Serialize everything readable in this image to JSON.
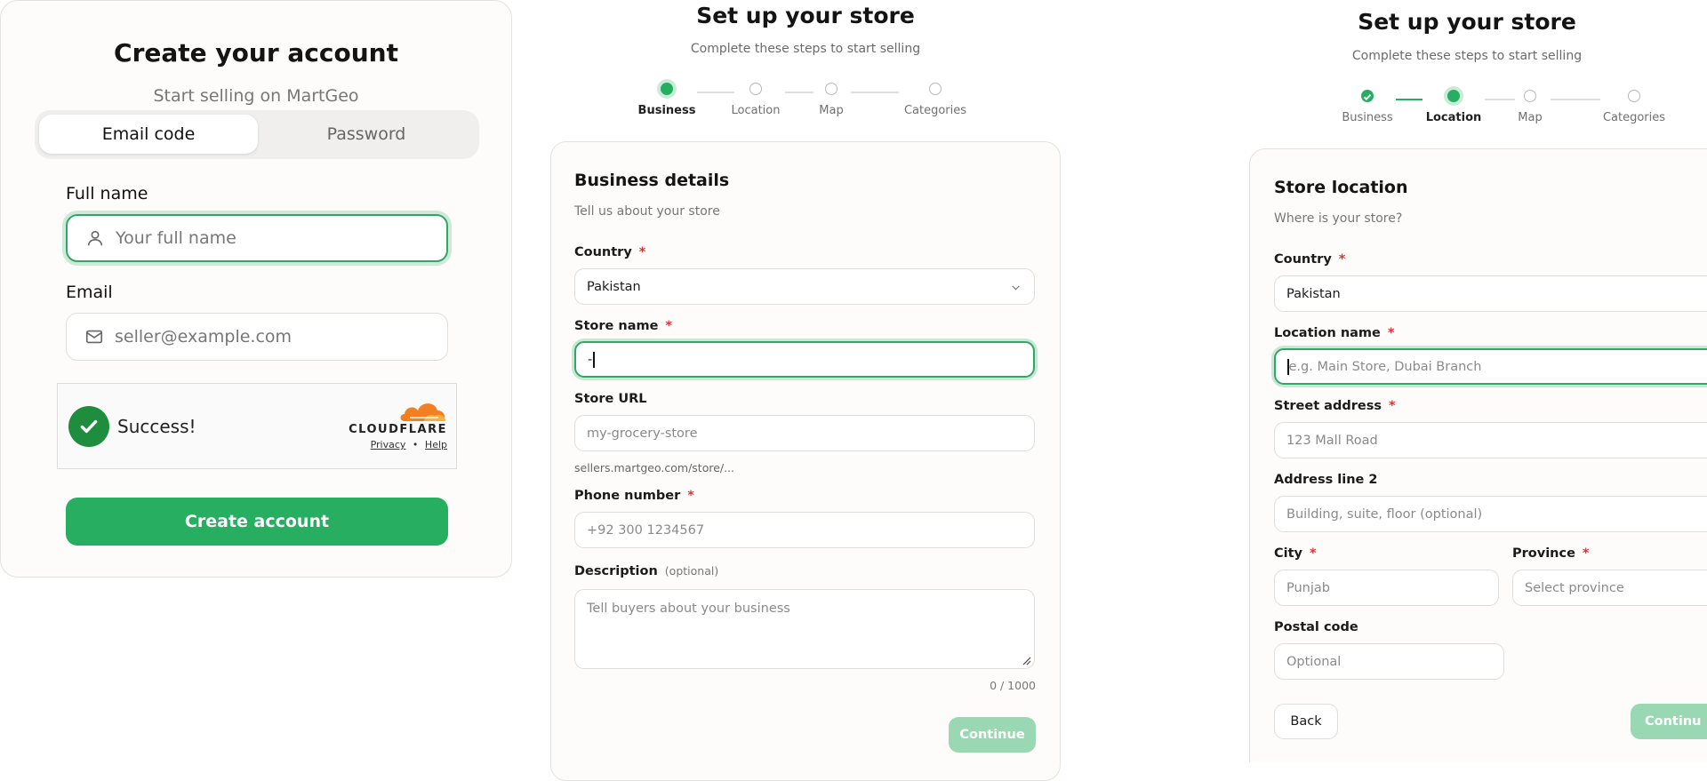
{
  "signup": {
    "title": "Create your account",
    "subtitle": "Start selling on MartGeo",
    "tabs": [
      {
        "label": "Email code",
        "active": true
      },
      {
        "label": "Password",
        "active": false
      }
    ],
    "full_name": {
      "label": "Full name",
      "placeholder": "Your full name",
      "icon": "user-icon"
    },
    "email": {
      "label": "Email",
      "placeholder": "seller@example.com",
      "icon": "mail-icon"
    },
    "captcha": {
      "status": "Success!",
      "brand": "CLOUDFLARE",
      "privacy": "Privacy",
      "separator": "•",
      "help": "Help"
    },
    "submit_label": "Create account",
    "accent": "#27ae60"
  },
  "setup_business": {
    "title": "Set up your store",
    "subtitle": "Complete these steps to start selling",
    "steps": [
      "Business",
      "Location",
      "Map",
      "Categories"
    ],
    "current_step": 0,
    "card": {
      "title": "Business details",
      "subtitle": "Tell us about your store",
      "country": {
        "label": "Country",
        "value": "Pakistan"
      },
      "store_name": {
        "label": "Store name",
        "value": "-"
      },
      "store_url": {
        "label": "Store URL",
        "placeholder": "my-grocery-store",
        "hint": "sellers.martgeo.com/store/..."
      },
      "phone": {
        "label": "Phone number",
        "placeholder": "+92 300 1234567"
      },
      "description": {
        "label": "Description",
        "optional_tag": "(optional)",
        "placeholder": "Tell buyers about your business",
        "counter": "0 / 1000"
      },
      "continue_label": "Continue"
    },
    "required_mark": "*"
  },
  "setup_location": {
    "title": "Set up your store",
    "subtitle": "Complete these steps to start selling",
    "steps": [
      "Business",
      "Location",
      "Map",
      "Categories"
    ],
    "current_step": 1,
    "card": {
      "title": "Store location",
      "subtitle": "Where is your store?",
      "country": {
        "label": "Country",
        "value": "Pakistan"
      },
      "location_name": {
        "label": "Location name",
        "placeholder": "e.g. Main Store, Dubai Branch"
      },
      "street": {
        "label": "Street address",
        "placeholder": "123 Mall Road"
      },
      "address2": {
        "label": "Address line 2",
        "placeholder": "Building, suite, floor (optional)"
      },
      "city": {
        "label": "City",
        "placeholder": "Punjab"
      },
      "province": {
        "label": "Province",
        "placeholder": "Select province"
      },
      "postal": {
        "label": "Postal code",
        "placeholder": "Optional"
      },
      "back_label": "Back",
      "continue_label": "Continu"
    },
    "required_mark": "*"
  }
}
